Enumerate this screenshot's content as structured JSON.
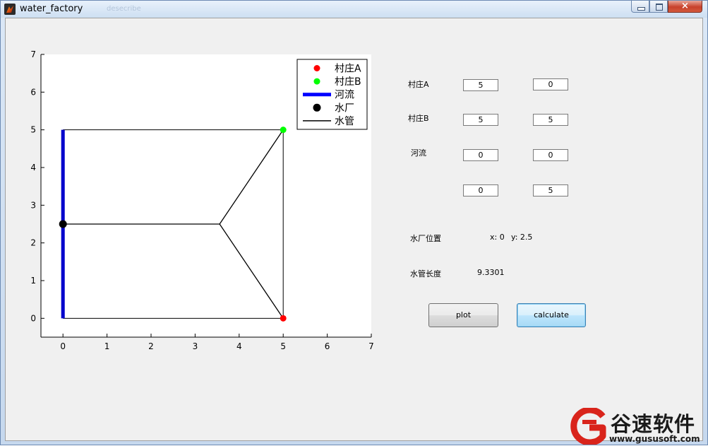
{
  "window": {
    "title": "water_factory",
    "ghost_title": "desecribe",
    "close_glyph": "×"
  },
  "axes": {
    "xticks": [
      "0",
      "1",
      "2",
      "3",
      "4",
      "5",
      "6",
      "7"
    ],
    "yticks": [
      "0",
      "1",
      "2",
      "3",
      "4",
      "5",
      "6",
      "7"
    ],
    "legend": [
      {
        "label": "村庄A",
        "marker": "red-dot",
        "color": "#ff0000"
      },
      {
        "label": "村庄B",
        "marker": "green-dot",
        "color": "#00ff00"
      },
      {
        "label": "河流",
        "marker": "blue-thick-line",
        "color": "#0000ff"
      },
      {
        "label": "水厂",
        "marker": "black-dot",
        "color": "#000000"
      },
      {
        "label": "水管",
        "marker": "black-line",
        "color": "#000000"
      }
    ]
  },
  "chart_data": {
    "type": "line",
    "xlim": [
      -0.5,
      7
    ],
    "ylim": [
      -0.5,
      7
    ],
    "grid": false,
    "legend_position": "top-right",
    "village_A": {
      "x": 5,
      "y": 0
    },
    "village_B": {
      "x": 5,
      "y": 5
    },
    "river": {
      "x": [
        0,
        0
      ],
      "y": [
        0,
        5
      ]
    },
    "plant": {
      "x": 0,
      "y": 2.5
    },
    "pipes": [
      {
        "x": [
          0,
          3.5566
        ],
        "y": [
          2.5,
          2.5
        ]
      },
      {
        "x": [
          3.5566,
          5
        ],
        "y": [
          2.5,
          5
        ]
      },
      {
        "x": [
          3.5566,
          5
        ],
        "y": [
          2.5,
          0
        ]
      }
    ],
    "boundary": {
      "x": [
        0,
        5,
        5,
        0
      ],
      "y": [
        5,
        5,
        0,
        0
      ]
    }
  },
  "form": {
    "villageA_label": "村庄A",
    "villageA_x": "5",
    "villageA_y": "0",
    "villageB_label": "村庄B",
    "villageB_x": "5",
    "villageB_y": "5",
    "river_label": "河流",
    "river_p1_x": "0",
    "river_p1_y": "0",
    "river_p2_x": "0",
    "river_p2_y": "5",
    "plant_position_label": "水厂位置",
    "plant_x_text": "x: 0",
    "plant_y_text": "y: 2.5",
    "pipe_length_label": "水管长度",
    "pipe_length_value": "9.3301",
    "plot_button": "plot",
    "calculate_button": "calculate"
  },
  "watermark": {
    "name": "谷速软件",
    "url": "www.gususoft.com",
    "color": "#d9241b"
  }
}
